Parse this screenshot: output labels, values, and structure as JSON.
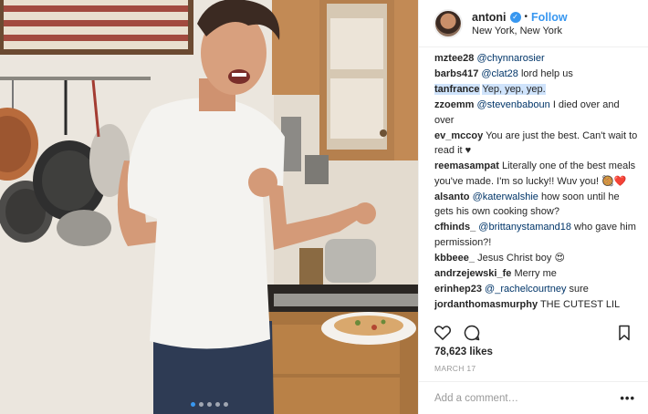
{
  "post": {
    "username": "antoni",
    "follow_label": "Follow",
    "location": "New York, New York",
    "separator": "•",
    "verified_icon": "✓"
  },
  "photo": {
    "carousel_dots": 5,
    "active_dot": 1
  },
  "comments": [
    {
      "user": "mztee28",
      "mention": "@chynnarosier",
      "text": ""
    },
    {
      "user": "barbs417",
      "mention": "@clat28",
      "text": " lord help us"
    },
    {
      "user": "tanfrance",
      "mention": "",
      "text": "Yep, yep, yep."
    },
    {
      "user": "zzoemm",
      "mention": "@stevenbaboun",
      "text": " I died over and over"
    },
    {
      "user": "ev_mccoy",
      "mention": "",
      "text": "You are just the best. Can't wait to read it ♥"
    },
    {
      "user": "reemasampat",
      "mention": "",
      "text": "Literally one of the best meals you've made. I'm so lucky!! Wuv you! 🥘❤️"
    },
    {
      "user": "alsanto",
      "mention": "@katerwalshie",
      "text": " how soon until he gets his own cooking show?"
    },
    {
      "user": "cfhinds_",
      "mention": "@brittanystamand18",
      "text": " who gave him permission?!"
    },
    {
      "user": "kbbeee_",
      "mention": "",
      "text": "Jesus Christ boy 😍"
    },
    {
      "user": "andrzejewski_fe",
      "mention": "",
      "text": "Merry me"
    },
    {
      "user": "erinhep23",
      "mention": "@_rachelcourtney",
      "text": " sure"
    },
    {
      "user": "jordanthomasmurphy",
      "mention": "",
      "text": "THE CUTEST LIL"
    }
  ],
  "engagement": {
    "likes_label": "78,623 likes",
    "date_label": "MARCH 17"
  },
  "composer": {
    "placeholder": "Add a comment…",
    "more_label": "•••"
  },
  "icons": {
    "like": "heart-icon",
    "comment": "comment-icon",
    "save": "bookmark-icon",
    "verified": "verified-badge-icon",
    "more": "more-options-icon"
  },
  "colors": {
    "accent": "#3897f0",
    "mention": "#003569",
    "highlight": "#cfe3fb",
    "muted": "#999999",
    "text": "#262626"
  }
}
